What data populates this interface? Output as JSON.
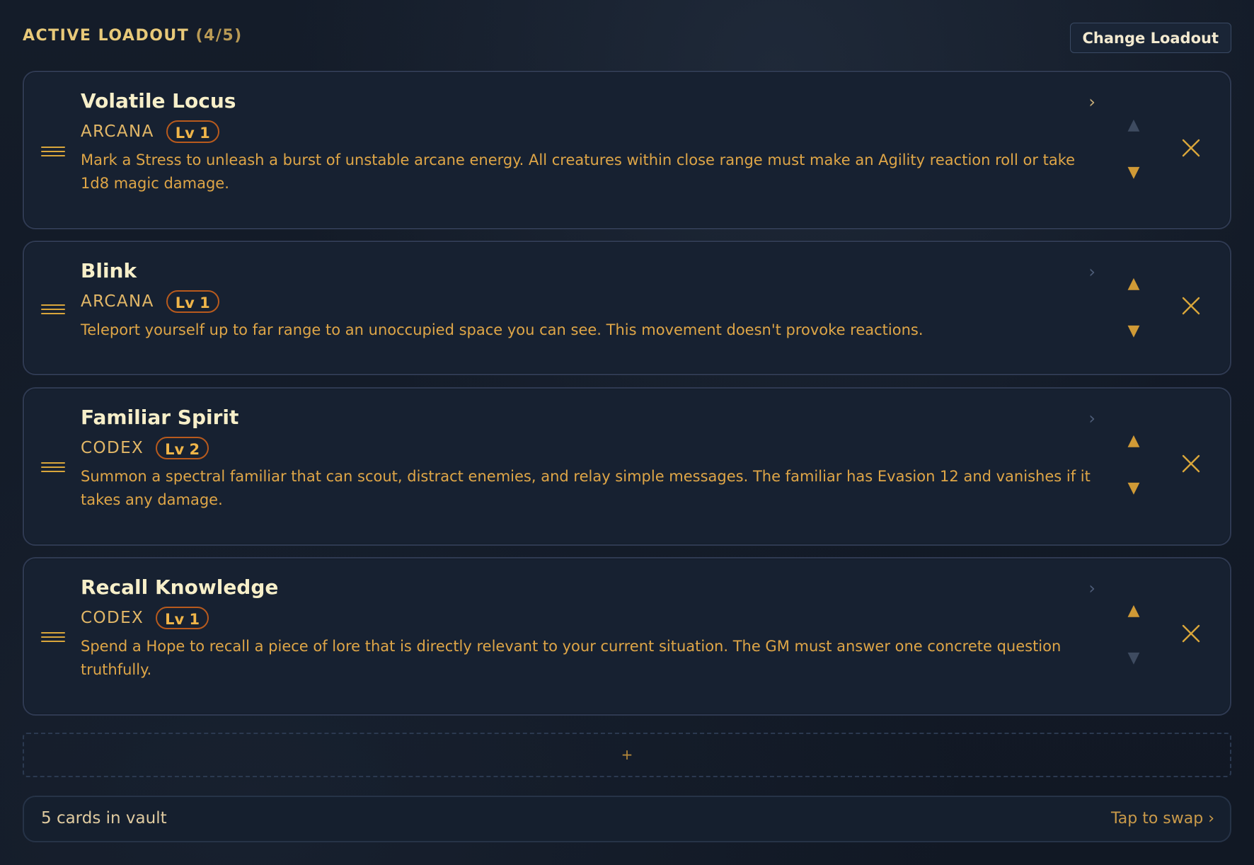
{
  "header": {
    "title": "ACTIVE LOADOUT",
    "count": "(4/5)",
    "change_button": "Change Loadout"
  },
  "icons": {
    "chevron": "›",
    "up": "▲",
    "down": "▼",
    "add": "+"
  },
  "cards": [
    {
      "title": "Volatile Locus",
      "domain": "ARCANA",
      "level": "Lv 1",
      "description": "Mark a Stress to unleash a burst of unstable arcane energy. All creatures within close range must make an Agility reaction roll or take 1d8 magic damage."
    },
    {
      "title": "Blink",
      "domain": "ARCANA",
      "level": "Lv 1",
      "description": "Teleport yourself up to far range to an unoccupied space you can see. This movement doesn't provoke reactions."
    },
    {
      "title": "Familiar Spirit",
      "domain": "CODEX",
      "level": "Lv 2",
      "description": "Summon a spectral familiar that can scout, distract enemies, and relay simple messages. The familiar has Evasion 12 and vanishes if it takes any damage."
    },
    {
      "title": "Recall Knowledge",
      "domain": "CODEX",
      "level": "Lv 1",
      "description": "Spend a Hope to recall a piece of lore that is directly relevant to your current situation. The GM must answer one concrete question truthfully."
    }
  ],
  "vault": {
    "count_text": "5 cards in vault",
    "swap_text": "Tap to swap ›"
  },
  "colors": {
    "accent_gold": "#e2b767",
    "badge_border": "#b85a1d",
    "card_bg": "#172131",
    "page_bg": "#121a26"
  }
}
